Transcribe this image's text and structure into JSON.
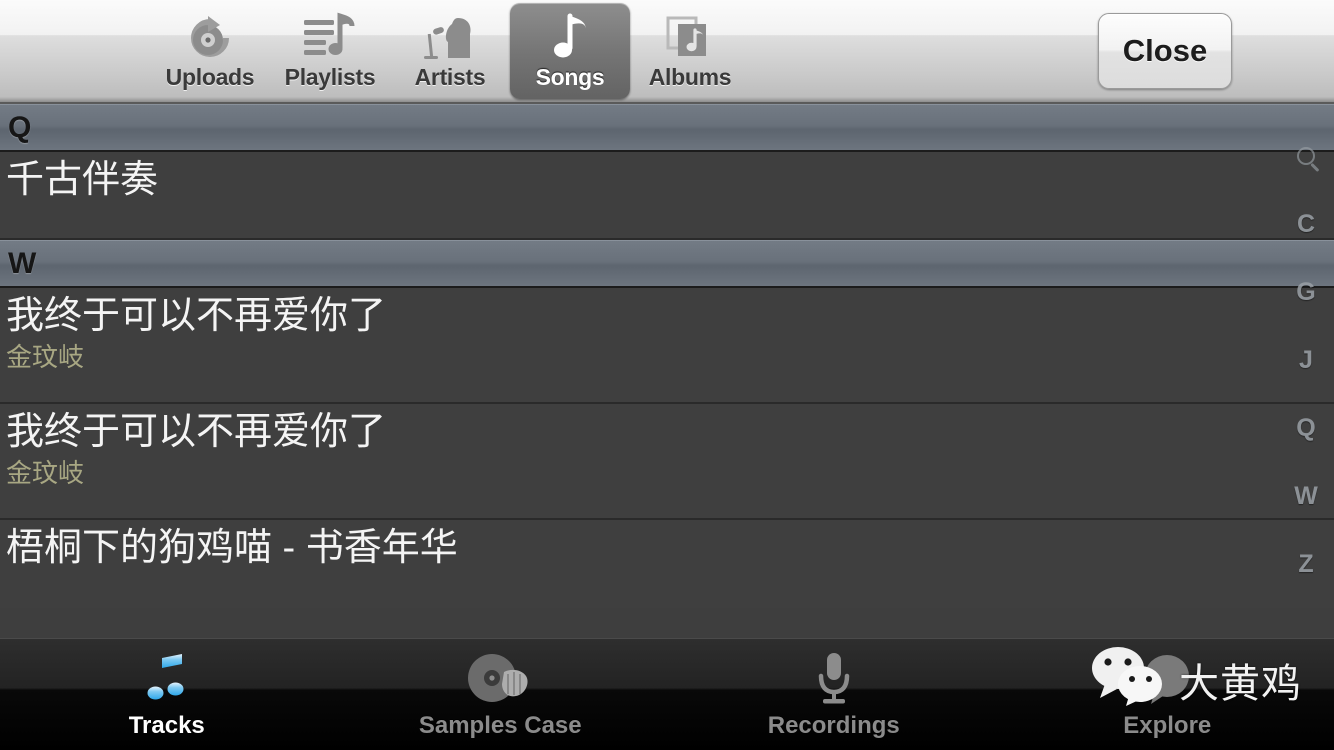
{
  "toolbar": {
    "items": [
      {
        "label": "Uploads",
        "icon": "record-upload-icon",
        "active": false
      },
      {
        "label": "Playlists",
        "icon": "playlist-note-icon",
        "active": false
      },
      {
        "label": "Artists",
        "icon": "singer-mic-icon",
        "active": false
      },
      {
        "label": "Songs",
        "icon": "music-note-icon",
        "active": true
      },
      {
        "label": "Albums",
        "icon": "album-stack-icon",
        "active": false
      }
    ],
    "close_label": "Close"
  },
  "list": {
    "sections": [
      {
        "header": "Q",
        "rows": [
          {
            "title": "千古伴奏",
            "artist": ""
          }
        ]
      },
      {
        "header": "W",
        "rows": [
          {
            "title": "我终于可以不再爱你了",
            "artist": "金玟岐"
          },
          {
            "title": "我终于可以不再爱你了",
            "artist": "金玟岐"
          },
          {
            "title": "梧桐下的狗鸡喵 - 书香年华",
            "artist": ""
          }
        ]
      }
    ]
  },
  "index_strip": {
    "search_icon": "search-icon",
    "letters": [
      "C",
      "G",
      "J",
      "Q",
      "W",
      "Z"
    ]
  },
  "tabbar": {
    "tabs": [
      {
        "label": "Tracks",
        "icon": "music-note-icon",
        "active": true
      },
      {
        "label": "Samples Case",
        "icon": "record-hand-icon",
        "active": false
      },
      {
        "label": "Recordings",
        "icon": "microphone-icon",
        "active": false
      },
      {
        "label": "Explore",
        "icon": "globe-bubble-icon",
        "active": false
      }
    ]
  },
  "watermark": {
    "icon": "wechat-logo-icon",
    "text": "大黄鸡"
  },
  "colors": {
    "toolbar_top": "#fbfbfb",
    "toolbar_bottom": "#8d8d8d",
    "list_bg": "#3e3e3e",
    "section_header": "#69717b",
    "title_text": "#f4f4f4",
    "artist_text": "#a8a783",
    "tab_active_text": "#ffffff",
    "tab_inactive_text": "#8b8b8b",
    "tab_active_icon": "#4db8f0"
  }
}
